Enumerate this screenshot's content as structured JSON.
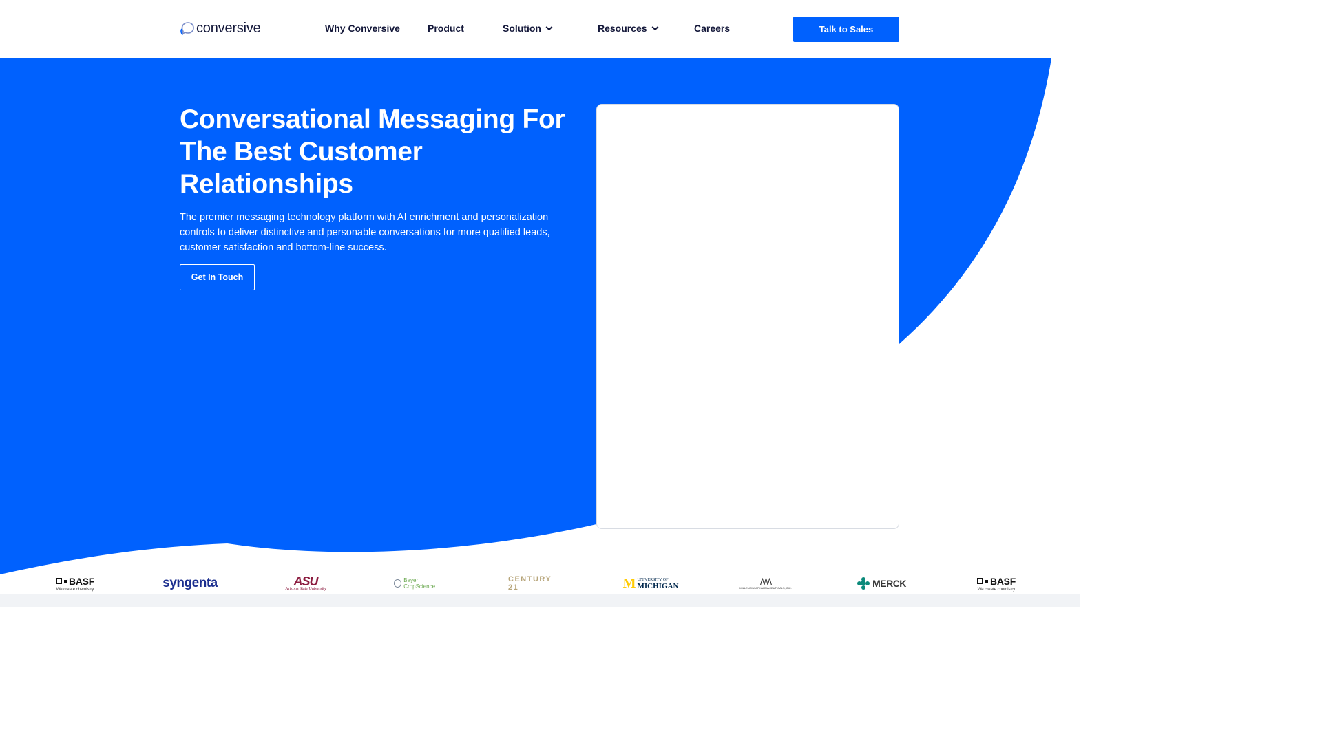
{
  "brand": {
    "name": "conversive",
    "primary_color": "#0061fe",
    "text_color": "#14183a"
  },
  "nav": {
    "items": [
      {
        "label": "Why Conversive",
        "has_dropdown": false
      },
      {
        "label": "Product",
        "has_dropdown": false
      },
      {
        "label": "Solution",
        "has_dropdown": true
      },
      {
        "label": "Resources",
        "has_dropdown": true
      },
      {
        "label": "Careers",
        "has_dropdown": false
      }
    ],
    "cta_label": "Talk to Sales"
  },
  "hero": {
    "title": "Conversational Messaging For The Best Customer Relationships",
    "subtitle": "The premier messaging technology platform with AI enrichment and personalization controls to deliver distinctive and personable conversations for more qualified leads, customer satisfaction and bottom-line success.",
    "button_label": "Get In Touch"
  },
  "client_logos": {
    "basf": {
      "name": "BASF",
      "tagline": "We create chemistry"
    },
    "syngenta": {
      "name": "syngenta"
    },
    "asu": {
      "name": "ASU",
      "tagline": "Arizona State University"
    },
    "bayer": {
      "name": "Bayer CropScience"
    },
    "century21": {
      "name": "CENTURY 21"
    },
    "umich": {
      "name_top": "UNIVERSITY OF",
      "name_bottom": "MICHIGAN"
    },
    "millennium": {
      "name": "MILLENNIUM PHARMACEUTICALS, INC."
    },
    "merck": {
      "name": "MERCK"
    }
  }
}
